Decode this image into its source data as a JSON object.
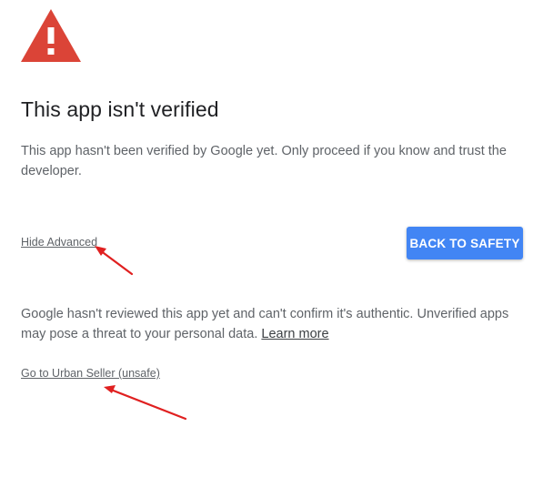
{
  "warning": {
    "icon": "warning-triangle-icon",
    "color": "#db4437"
  },
  "title": "This app isn't verified",
  "description": "This app hasn't been verified by Google yet. Only proceed if you know and trust the developer.",
  "actions": {
    "hide_advanced": "Hide Advanced",
    "back_to_safety": "BACK TO SAFETY"
  },
  "advanced": {
    "text": "Google hasn't reviewed this app yet and can't confirm it's authentic. Unverified apps may pose a threat to your personal data.",
    "learn_more": "Learn more",
    "proceed": "Go to Urban Seller (unsafe)"
  },
  "colors": {
    "accent": "#4285f4",
    "annotation_arrow": "#e02020"
  }
}
